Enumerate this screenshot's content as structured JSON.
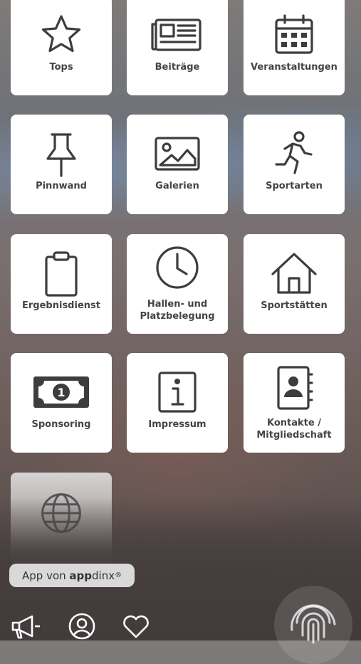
{
  "tiles": [
    {
      "label": "Tops",
      "icon": "star-icon"
    },
    {
      "label": "Beiträge",
      "icon": "newspaper-icon"
    },
    {
      "label": "Veranstaltungen",
      "icon": "calendar-icon"
    },
    {
      "label": "Pinnwand",
      "icon": "pushpin-icon"
    },
    {
      "label": "Galerien",
      "icon": "image-icon"
    },
    {
      "label": "Sportarten",
      "icon": "runner-icon"
    },
    {
      "label": "Ergebnisdienst",
      "icon": "clipboard-icon"
    },
    {
      "label": "Hallen- und\nPlatzbelegung",
      "icon": "clock-icon"
    },
    {
      "label": "Sportstätten",
      "icon": "house-icon"
    },
    {
      "label": "Sponsoring",
      "icon": "banknote-icon"
    },
    {
      "label": "Impressum",
      "icon": "info-icon"
    },
    {
      "label": "Kontakte /\nMitgliedschaft",
      "icon": "contacts-book-icon"
    },
    {
      "label": "",
      "icon": "globe-icon"
    }
  ],
  "badge": {
    "prefix": "App von ",
    "brand_bold": "app",
    "brand_rest": "dinx",
    "mark": "®"
  },
  "toolbar": {
    "icons": [
      "megaphone-icon",
      "user-icon",
      "heart-icon",
      "fingerprint-icon"
    ]
  },
  "colors": {
    "tile_bg": "#ffffff",
    "icon": "#3d3d3d",
    "label": "#444444",
    "badge_bg": "#d9d9d9"
  }
}
